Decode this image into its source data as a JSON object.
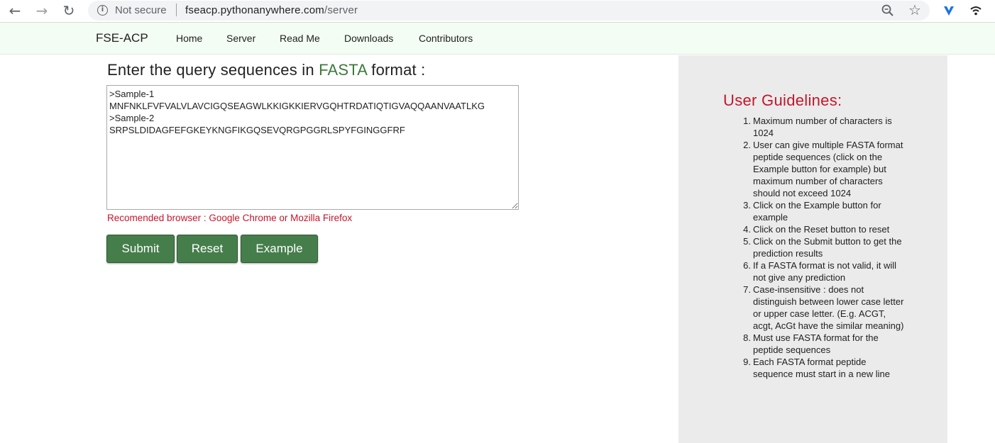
{
  "browser": {
    "security_label": "Not secure",
    "url_host": "fseacp.pythonanywhere.com",
    "url_path": "/server",
    "back_icon": "arrow-left-icon",
    "forward_icon": "arrow-right-icon",
    "reload_icon": "reload-icon"
  },
  "navbar": {
    "brand": "FSE-ACP",
    "links": [
      "Home",
      "Server",
      "Read Me",
      "Downloads",
      "Contributors"
    ]
  },
  "main": {
    "heading_prefix": "Enter the query sequences in ",
    "heading_highlight": "FASTA",
    "heading_suffix": " format :",
    "sequence_value": ">Sample-1\nMNFNKLFVFVALVLAVCIGQSEAGWLKKIGKKIERVGQHTRDATIQTIGVAQQAANVAATLKG\n>Sample-2\nSRPSLDIDAGFEFGKEYKNGFIKGQSEVQRGPGGRLSPYFGINGGFRF",
    "browser_note": "Recomended browser : Google Chrome or Mozilla Firefox",
    "buttons": {
      "submit": "Submit",
      "reset": "Reset",
      "example": "Example"
    }
  },
  "guidelines": {
    "title": "User Guidelines:",
    "items": [
      "Maximum number of characters is 1024",
      "User can give multiple FASTA format peptide sequences (click on the Example button for example) but maximum number of characters should not exceed 1024",
      "Click on the Example button for example",
      "Click on the Reset button to reset",
      "Click on the Submit button to get the prediction results",
      "If a FASTA format is not valid, it will not give any prediction",
      "Case-insensitive : does not distinguish between lower case letter or upper case letter. (E.g. ACGT, acgt, AcGt have the similar meaning)",
      "Must use FASTA format for the peptide sequences",
      "Each FASTA format peptide sequence must start in a new line"
    ]
  },
  "colors": {
    "accent_green": "#467e4b",
    "fasta_green": "#3c7a3c",
    "alert_red": "#c4162a",
    "navbar_bg": "#f3fdf3",
    "panel_bg": "#ebebeb"
  }
}
